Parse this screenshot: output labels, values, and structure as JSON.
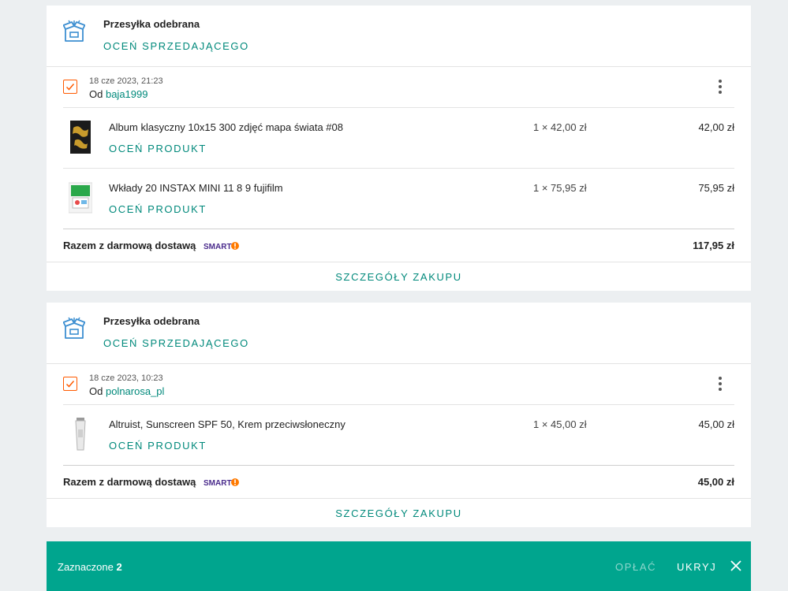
{
  "orders": [
    {
      "status": "Przesyłka odebrana",
      "rate_seller": "OCEŃ SPRZEDAJĄCEGO",
      "date": "18 cze 2023, 21:23",
      "from_label": "Od",
      "seller": "baja1999",
      "items": [
        {
          "name": "Album klasyczny 10x15 300 zdjęć mapa świata #08",
          "qty": "1 × 42,00 zł",
          "price": "42,00 zł",
          "rate": "OCEŃ PRODUKT"
        },
        {
          "name": "Wkłady 20 INSTAX MINI 11 8 9 fujifilm",
          "qty": "1 × 75,95 zł",
          "price": "75,95 zł",
          "rate": "OCEŃ PRODUKT"
        }
      ],
      "total_label": "Razem z darmową dostawą",
      "total": "117,95 zł",
      "details": "SZCZEGÓŁY ZAKUPU"
    },
    {
      "status": "Przesyłka odebrana",
      "rate_seller": "OCEŃ SPRZEDAJĄCEGO",
      "date": "18 cze 2023, 10:23",
      "from_label": "Od",
      "seller": "polnarosa_pl",
      "items": [
        {
          "name": "Altruist, Sunscreen SPF 50, Krem przeciwsłoneczny",
          "qty": "1 × 45,00 zł",
          "price": "45,00 zł",
          "rate": "OCEŃ PRODUKT"
        }
      ],
      "total_label": "Razem z darmową dostawą",
      "total": "45,00 zł",
      "details": "SZCZEGÓŁY ZAKUPU"
    }
  ],
  "smart_badge": "SMART",
  "bottom_bar": {
    "selected_label": "Zaznaczone",
    "selected_count": "2",
    "pay": "OPŁAĆ",
    "hide": "UKRYJ"
  },
  "colors": {
    "accent": "#00897b",
    "bar": "#00a58e",
    "checkbox": "#ff5a00",
    "smart": "#4a2b8c"
  },
  "icons": [
    "package-open-icon",
    "checkbox-checked-icon",
    "more-vertical-icon",
    "close-icon"
  ]
}
